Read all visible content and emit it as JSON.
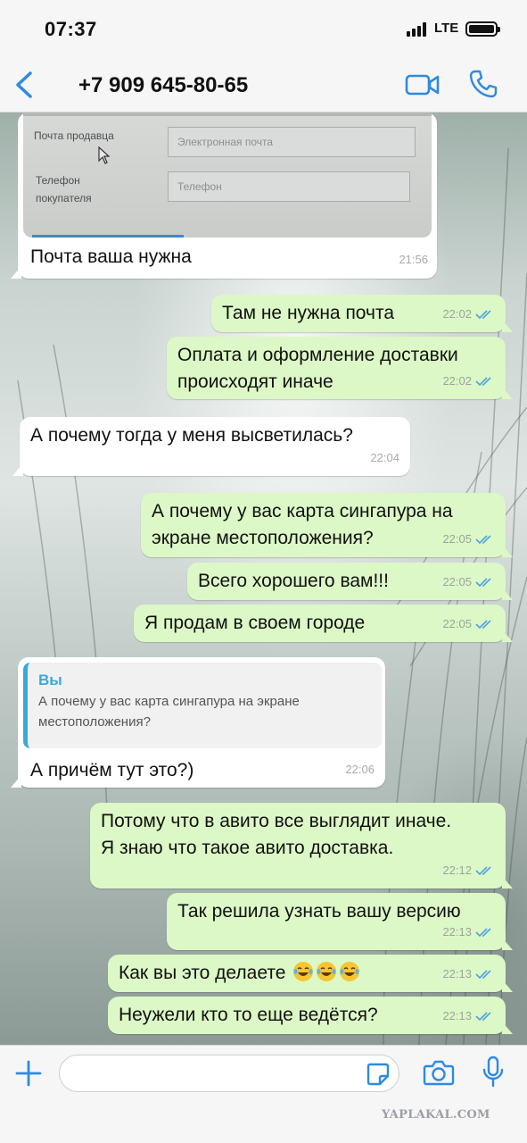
{
  "status_bar": {
    "time": "07:37",
    "network": "LTE"
  },
  "header": {
    "contact": "+7 909 645-80-65"
  },
  "screenshot_form": {
    "seller_email_label": "Почта продавца",
    "email_placeholder": "Электронная почта",
    "buyer_phone_label_line1": "Телефон",
    "buyer_phone_label_line2": "покупателя",
    "phone_placeholder": "Телефон"
  },
  "messages": [
    {
      "dir": "in",
      "text": "Почта ваша нужна",
      "time": "21:56"
    },
    {
      "dir": "out",
      "text": "Там не нужна почта",
      "time": "22:02"
    },
    {
      "dir": "out",
      "lines": [
        "Оплата и оформление доставки",
        "происходят иначе"
      ],
      "time": "22:02"
    },
    {
      "dir": "in",
      "text": "А почему тогда у меня высветилась?",
      "time": "22:04"
    },
    {
      "dir": "out",
      "lines": [
        "А почему у вас карта сингапура на",
        "экране местоположения?"
      ],
      "time": "22:05"
    },
    {
      "dir": "out",
      "text": "Всего хорошего вам!!!",
      "time": "22:05"
    },
    {
      "dir": "out",
      "text": "Я продам в своем городе",
      "time": "22:05"
    },
    {
      "dir": "in",
      "quote_author": "Вы",
      "quote_lines": [
        "А почему у вас карта сингапура на экране",
        "местоположения?"
      ],
      "text": "А причём тут это?)",
      "time": "22:06"
    },
    {
      "dir": "out",
      "lines": [
        "Потому что в авито все выглядит иначе.",
        "Я знаю что такое авито доставка."
      ],
      "time": "22:12"
    },
    {
      "dir": "out",
      "text": "Так решила узнать вашу версию",
      "time": "22:13"
    },
    {
      "dir": "out",
      "text": "Как вы это делаете",
      "emoji": "face-with-tears-of-joy x3",
      "time": "22:13"
    },
    {
      "dir": "out",
      "text": "Неужели кто то еще ведётся?",
      "time": "22:13"
    }
  ],
  "watermark": "YAPLAKAL.COM",
  "colors": {
    "accent": "#2f8ae0",
    "outgoing_bubble": "#dcf8c6",
    "incoming_bubble": "#ffffff",
    "read_ticks": "#4fa3e0"
  }
}
